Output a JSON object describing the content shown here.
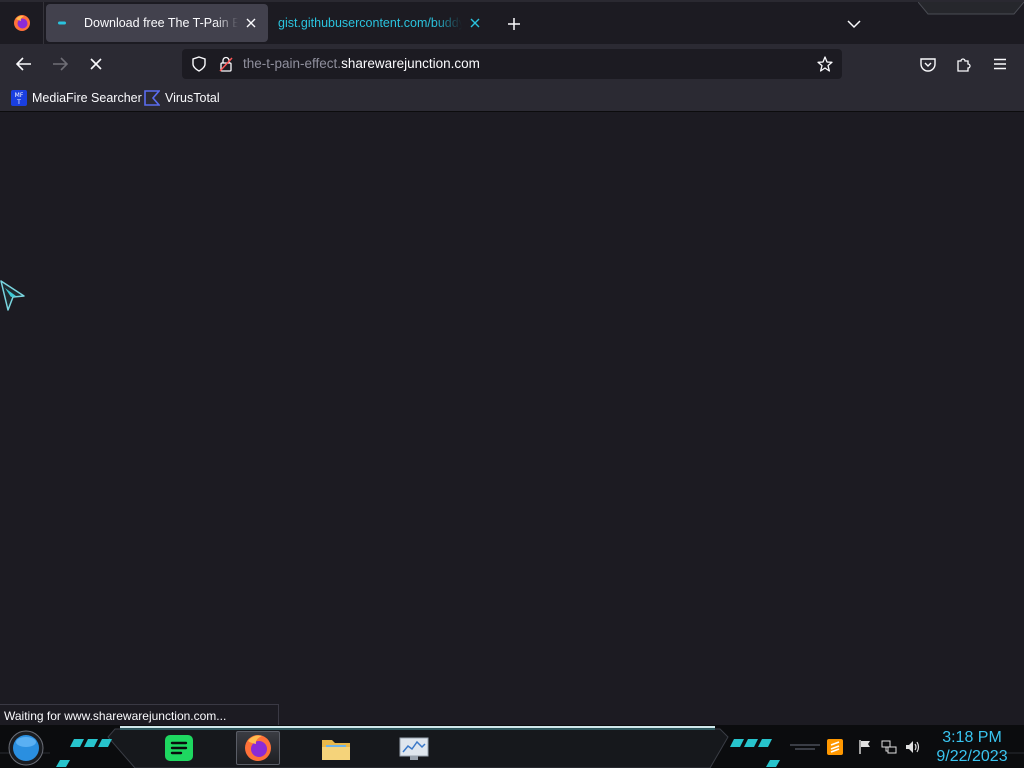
{
  "tabs": [
    {
      "title": "Download free The T-Pain Effect",
      "favicon": "loading-throbber-icon",
      "active": true
    },
    {
      "title": "gist.githubusercontent.com/buddy",
      "favicon": null,
      "active": false
    }
  ],
  "tabstrip": {
    "new_tab_icon": "plus-icon",
    "list_all_tabs_icon": "chevron-down-icon",
    "app_icon": "firefox-icon"
  },
  "navbar": {
    "back_icon": "arrow-left-icon",
    "forward_icon": "arrow-right-icon",
    "stop_icon": "close-icon",
    "url": {
      "subdomain": "the-t-pain-effect.",
      "domain": "sharewarejunction.com"
    },
    "tracking_protection_icon": "shield-icon",
    "permissions_icon": "lock-slash-icon",
    "bookmark_star_icon": "star-icon",
    "pocket_icon": "pocket-icon",
    "extensions_icon": "puzzle-icon",
    "menu_icon": "hamburger-menu-icon"
  },
  "bookmarks": [
    {
      "label": "MediaFire Searcher",
      "icon": "mediafire-icon",
      "icon_text": "MF\nT"
    },
    {
      "label": "VirusTotal",
      "icon": "virustotal-icon"
    }
  ],
  "status": {
    "text": "Waiting for www.sharewarejunction.com..."
  },
  "taskbar": {
    "start_icon": "start-orb-icon",
    "apps": [
      {
        "name": "spotify",
        "icon": "spotify-icon",
        "active": false
      },
      {
        "name": "firefox",
        "icon": "firefox-icon",
        "active": true
      },
      {
        "name": "file-explorer",
        "icon": "folder-icon",
        "active": false
      },
      {
        "name": "system-monitor",
        "icon": "monitor-chart-icon",
        "active": false
      }
    ],
    "tray": [
      "sublime-text-icon",
      "flag-icon",
      "network-icon",
      "volume-icon"
    ],
    "clock": {
      "time": "3:18 PM",
      "date": "9/22/2023"
    }
  },
  "colors": {
    "accent_cyan": "#2ac3de",
    "clock": "#39c5f0",
    "chrome_bg": "#2b2a33",
    "content_bg": "#1c1b22",
    "active_tab": "#42414d"
  }
}
